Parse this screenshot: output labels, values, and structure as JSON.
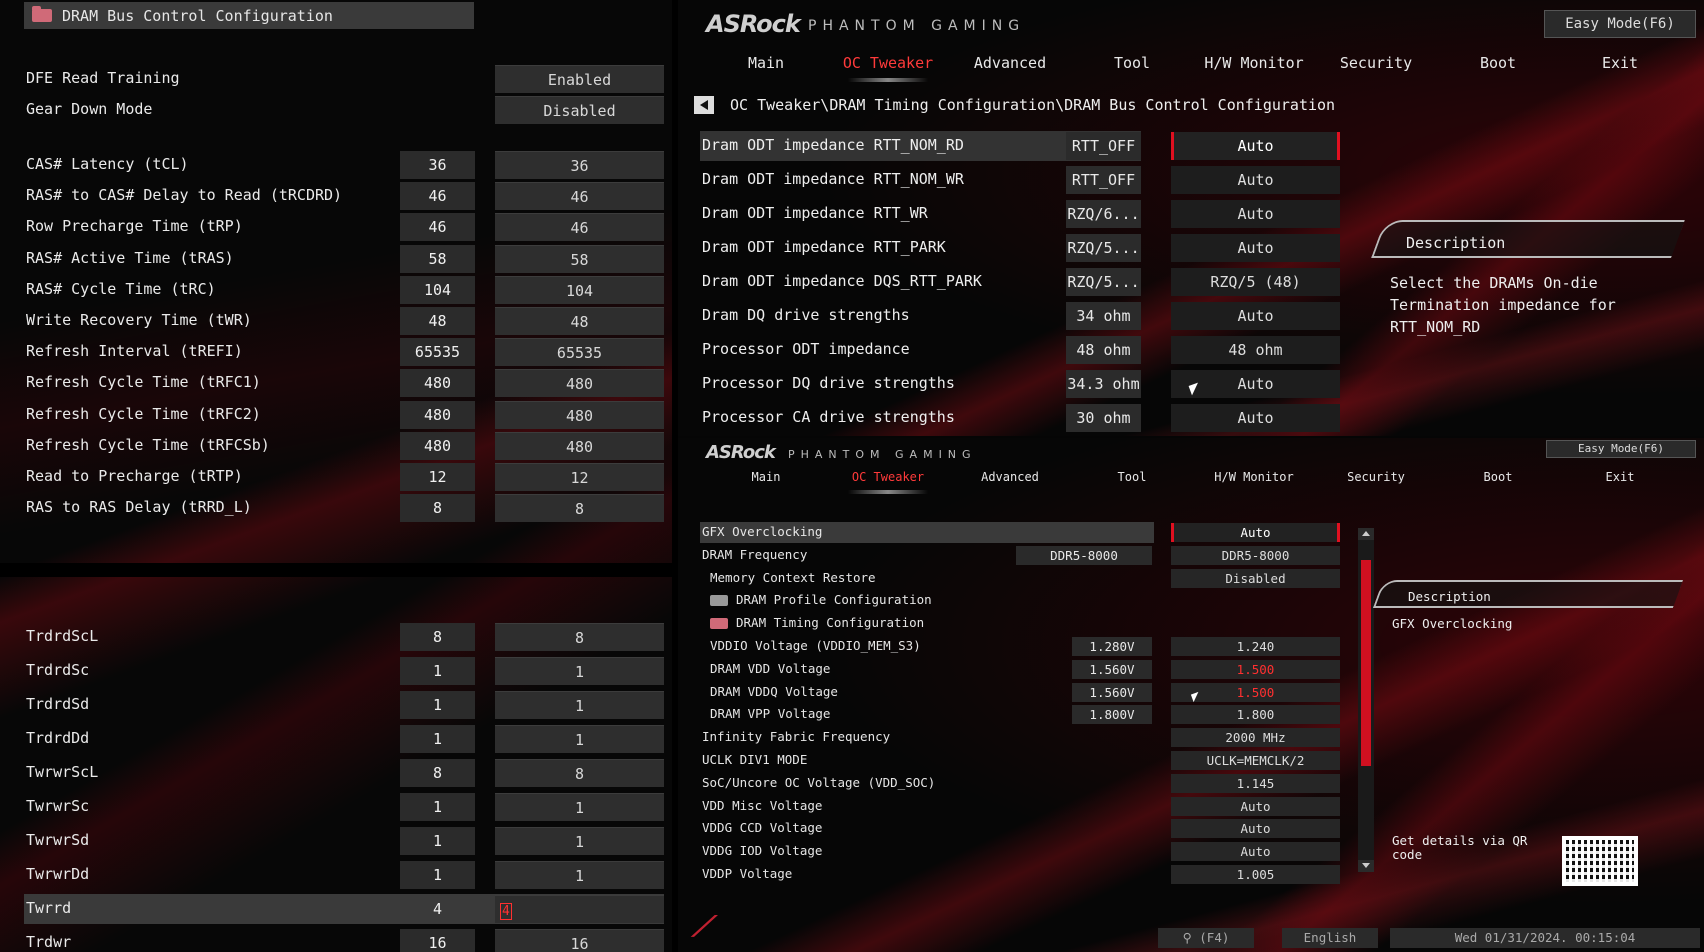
{
  "left": {
    "header": "DRAM Bus Control Configuration",
    "top_rows": [
      {
        "label": "DFE Read Training",
        "set": "Enabled"
      },
      {
        "label": "Gear Down Mode",
        "set": "Disabled"
      }
    ],
    "timings": [
      {
        "label": "CAS# Latency (tCL)",
        "cur": "36",
        "set": "36"
      },
      {
        "label": "RAS# to CAS# Delay to Read  (tRCDRD)",
        "cur": "46",
        "set": "46"
      },
      {
        "label": "Row Precharge Time (tRP)",
        "cur": "46",
        "set": "46"
      },
      {
        "label": "RAS# Active Time (tRAS)",
        "cur": "58",
        "set": "58"
      },
      {
        "label": "RAS# Cycle Time (tRC)",
        "cur": "104",
        "set": "104"
      },
      {
        "label": "Write Recovery Time (tWR)",
        "cur": "48",
        "set": "48"
      },
      {
        "label": "Refresh Interval (tREFI)",
        "cur": "65535",
        "set": "65535"
      },
      {
        "label": "Refresh Cycle Time (tRFC1)",
        "cur": "480",
        "set": "480"
      },
      {
        "label": "Refresh Cycle Time (tRFC2)",
        "cur": "480",
        "set": "480"
      },
      {
        "label": "Refresh Cycle Time (tRFCSb)",
        "cur": "480",
        "set": "480"
      },
      {
        "label": "Read to Precharge (tRTP)",
        "cur": "12",
        "set": "12"
      },
      {
        "label": "RAS to RAS Delay (tRRD_L)",
        "cur": "8",
        "set": "8"
      }
    ],
    "subtimings": [
      {
        "label": "TrdrdScL",
        "cur": "8",
        "set": "8"
      },
      {
        "label": "TrdrdSc",
        "cur": "1",
        "set": "1"
      },
      {
        "label": "TrdrdSd",
        "cur": "1",
        "set": "1"
      },
      {
        "label": "TrdrdDd",
        "cur": "1",
        "set": "1"
      },
      {
        "label": "TwrwrScL",
        "cur": "8",
        "set": "8"
      },
      {
        "label": "TwrwrSc",
        "cur": "1",
        "set": "1"
      },
      {
        "label": "TwrwrSd",
        "cur": "1",
        "set": "1"
      },
      {
        "label": "TwrwrDd",
        "cur": "1",
        "set": "1"
      },
      {
        "label": "Twrrd",
        "cur": "4",
        "set": "4"
      },
      {
        "label": "Trdwr",
        "cur": "16",
        "set": "16"
      }
    ]
  },
  "top": {
    "logo": "ASRock",
    "logo_sub": "PHANTOM GAMING",
    "easy_mode": "Easy Mode(F6)",
    "tabs": [
      "Main",
      "OC Tweaker",
      "Advanced",
      "Tool",
      "H/W Monitor",
      "Security",
      "Boot",
      "Exit"
    ],
    "active_tab": "OC Tweaker",
    "breadcrumb": "OC Tweaker\\DRAM Timing Configuration\\DRAM Bus Control Configuration",
    "rows": [
      {
        "label": "Dram ODT impedance RTT_NOM_RD",
        "cur": "RTT_OFF",
        "set": "Auto"
      },
      {
        "label": "Dram ODT impedance RTT_NOM_WR",
        "cur": "RTT_OFF",
        "set": "Auto"
      },
      {
        "label": "Dram ODT impedance RTT_WR",
        "cur": "RZQ/6...",
        "set": "Auto"
      },
      {
        "label": "Dram ODT impedance RTT_PARK",
        "cur": "RZQ/5...",
        "set": "Auto"
      },
      {
        "label": "Dram ODT impedance DQS_RTT_PARK",
        "cur": "RZQ/5...",
        "set": "RZQ/5 (48)"
      },
      {
        "label": "Dram DQ drive strengths",
        "cur": "34 ohm",
        "set": "Auto"
      },
      {
        "label": "Processor ODT impedance",
        "cur": "48 ohm",
        "set": "48 ohm"
      },
      {
        "label": "Processor DQ drive strengths",
        "cur": "34.3 ohm",
        "set": "Auto"
      },
      {
        "label": "Processor CA drive strengths",
        "cur": "30 ohm",
        "set": "Auto"
      }
    ],
    "desc_title": "Description",
    "desc_text": "Select the DRAMs On-die Termination impedance for RTT_NOM_RD"
  },
  "bottom": {
    "logo": "ASRock",
    "logo_sub": "PHANTOM GAMING",
    "easy_mode": "Easy Mode(F6)",
    "tabs": [
      "Main",
      "OC Tweaker",
      "Advanced",
      "Tool",
      "H/W Monitor",
      "Security",
      "Boot",
      "Exit"
    ],
    "rows": [
      {
        "label": "GFX Overclocking",
        "cur": "",
        "set": "Auto"
      },
      {
        "label": "DRAM Frequency",
        "cur": "DDR5-8000",
        "set": "DDR5-8000"
      },
      {
        "label": " Memory Context Restore",
        "cur": "",
        "set": "Disabled"
      },
      {
        "label": "DRAM Profile Configuration",
        "cur": "",
        "set": "",
        "folder": true
      },
      {
        "label": "DRAM Timing Configuration",
        "cur": "",
        "set": "",
        "folder": true
      },
      {
        "label": " VDDIO Voltage (VDDIO_MEM_S3)",
        "cur": "1.280V",
        "set": "1.240"
      },
      {
        "label": " DRAM VDD Voltage",
        "cur": "1.560V",
        "set": "1.500"
      },
      {
        "label": " DRAM VDDQ Voltage",
        "cur": "1.560V",
        "set": "1.500"
      },
      {
        "label": " DRAM VPP Voltage",
        "cur": "1.800V",
        "set": "1.800"
      },
      {
        "label": "Infinity Fabric Frequency",
        "cur": "",
        "set": "2000 MHz"
      },
      {
        "label": "UCLK DIV1 MODE",
        "cur": "",
        "set": "UCLK=MEMCLK/2"
      },
      {
        "label": "SoC/Uncore OC Voltage (VDD_SOC)",
        "cur": "",
        "set": "1.145"
      },
      {
        "label": "VDD Misc Voltage",
        "cur": "",
        "set": "Auto"
      },
      {
        "label": "VDDG CCD Voltage",
        "cur": "",
        "set": "Auto"
      },
      {
        "label": "VDDG IOD Voltage",
        "cur": "",
        "set": "Auto"
      },
      {
        "label": "VDDP Voltage",
        "cur": "",
        "set": "1.005"
      }
    ],
    "desc_title": "Description",
    "desc_text": "GFX Overclocking",
    "qr_text": "Get details via QR code",
    "search": "(F4)",
    "language": "English",
    "datetime": "Wed 01/31/2024. 00:15:04"
  },
  "colors": {
    "accent": "#e01020",
    "warn_text": "#ff3030"
  }
}
